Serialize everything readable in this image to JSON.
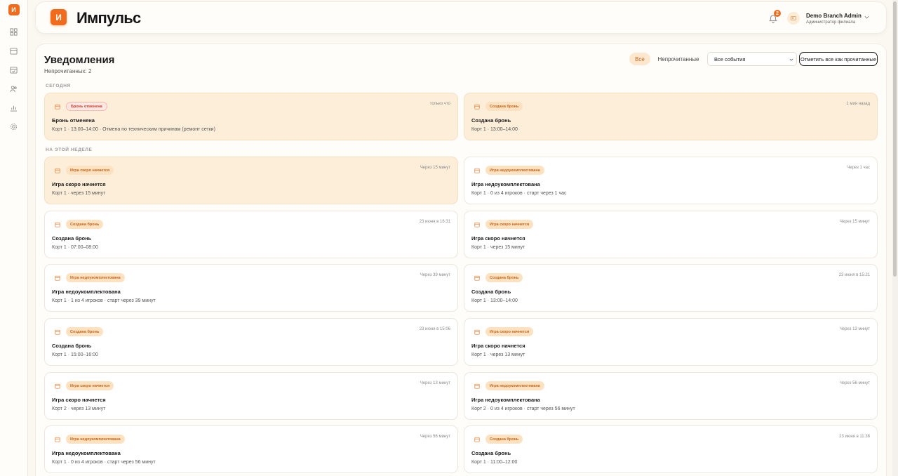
{
  "app": {
    "logo_glyph": "И",
    "brand": "Импульс",
    "accent_color": "#f26b1d"
  },
  "sidebar": {
    "items": [
      {
        "icon": "grid-icon"
      },
      {
        "icon": "calendar-icon"
      },
      {
        "icon": "calendar-check-icon"
      },
      {
        "icon": "users-icon"
      },
      {
        "icon": "chart-icon"
      },
      {
        "icon": "gear-icon"
      }
    ]
  },
  "header": {
    "notifications_count": "2",
    "user_name": "Demo Branch Admin",
    "user_role": "Администратор филиала"
  },
  "page": {
    "title": "Уведомления",
    "unread": "Непрочитанных: 2",
    "filter_all": "Все",
    "filter_unread": "Непрочитанные",
    "events_select": "Все события",
    "mark_all": "Отметить все как прочитанные"
  },
  "sections": {
    "today": "СЕГОДНЯ",
    "this_week": "НА ЭТОЙ НЕДЕЛЕ"
  },
  "notifications": [
    {
      "tag": "Бронь отменена",
      "tag_type": "cancel",
      "time": "только что",
      "title": "Бронь отменена",
      "body": "Корт 1 · 13:00–14:00 · Отмена по техническим причинам (ремонт сетки)",
      "unread": true
    },
    {
      "tag": "Создана бронь",
      "tag_type": "created",
      "time": "1 мин назад",
      "title": "Создана бронь",
      "body": "Корт 1 · 13:00–14:00",
      "unread": true
    },
    {
      "tag": "Игра скоро начнется",
      "tag_type": "created",
      "time": "Через 15 минут",
      "title": "Игра скоро начнется",
      "body": "Корт 1 · через 15 минут",
      "unread": true
    },
    {
      "tag": "Игра недоукомплектована",
      "tag_type": "created",
      "time": "Через 1 час",
      "title": "Игра недоукомплектована",
      "body": "Корт 1 · 0 из 4 игроков · старт через 1 час",
      "unread": false
    },
    {
      "tag": "Создана бронь",
      "tag_type": "created",
      "time": "23 июня в 16:31",
      "title": "Создана бронь",
      "body": "Корт 1 · 07:00–08:00",
      "unread": false
    },
    {
      "tag": "Игра скоро начнется",
      "tag_type": "created",
      "time": "Через 15 минут",
      "title": "Игра скоро начнется",
      "body": "Корт 1 · через 15 минут",
      "unread": false
    },
    {
      "tag": "Игра недоукомплектована",
      "tag_type": "created",
      "time": "Через 39 минут",
      "title": "Игра недоукомплектована",
      "body": "Корт 1 · 1 из 4 игроков · старт через 39 минут",
      "unread": false
    },
    {
      "tag": "Создана бронь",
      "tag_type": "created",
      "time": "23 июня в 15:21",
      "title": "Создана бронь",
      "body": "Корт 1 · 13:00–14:00",
      "unread": false
    },
    {
      "tag": "Создана бронь",
      "tag_type": "created",
      "time": "23 июня в 15:06",
      "title": "Создана бронь",
      "body": "Корт 1 · 15:00–16:00",
      "unread": false
    },
    {
      "tag": "Игра скоро начнется",
      "tag_type": "created",
      "time": "Через 13 минут",
      "title": "Игра скоро начнется",
      "body": "Корт 1 · через 13 минут",
      "unread": false
    },
    {
      "tag": "Игра скоро начнется",
      "tag_type": "created",
      "time": "Через 13 минут",
      "title": "Игра скоро начнется",
      "body": "Корт 2 · через 13 минут",
      "unread": false
    },
    {
      "tag": "Игра недоукомплектована",
      "tag_type": "created",
      "time": "Через 56 минут",
      "title": "Игра недоукомплектована",
      "body": "Корт 2 · 0 из 4 игроков · старт через 56 минут",
      "unread": false
    },
    {
      "tag": "Игра недоукомплектована",
      "tag_type": "created",
      "time": "Через 56 минут",
      "title": "Игра недоукомплектована",
      "body": "Корт 1 · 0 из 4 игроков · старт через 56 минут",
      "unread": false
    },
    {
      "tag": "Создана бронь",
      "tag_type": "created",
      "time": "23 июня в 11:38",
      "title": "Создана бронь",
      "body": "Корт 1 · 11:00–12:00",
      "unread": false
    }
  ]
}
